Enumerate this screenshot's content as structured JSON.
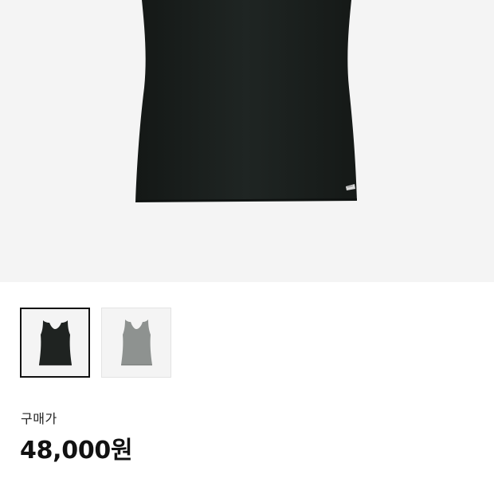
{
  "product": {
    "main_image": {
      "icon": "tank-top-black-image",
      "garment_color": "#1e2422",
      "background_color": "#f4f4f4"
    },
    "thumbnails": [
      {
        "icon": "tank-top-black-thumbnail",
        "color": "#1f2321",
        "selected": true
      },
      {
        "icon": "tank-top-gray-thumbnail",
        "color": "#8e9290",
        "selected": false
      }
    ],
    "price_label": "구매가",
    "price": "48,000원"
  }
}
